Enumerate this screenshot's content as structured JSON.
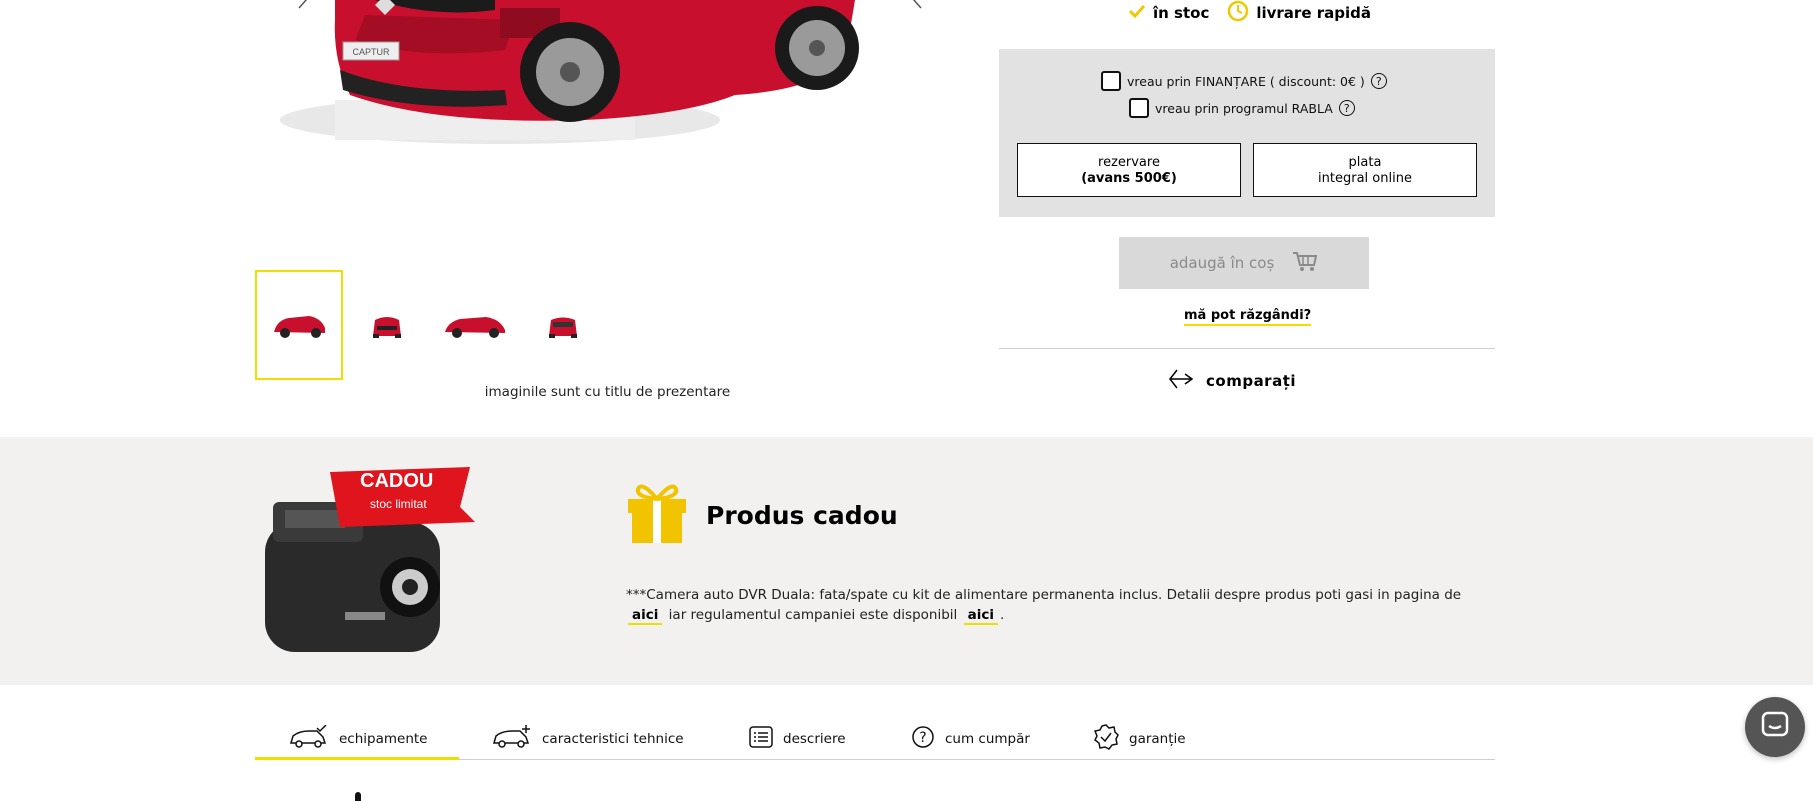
{
  "gallery": {
    "disclaimer": "imaginile sunt cu titlu de prezentare",
    "plate_text": "CAPTUR",
    "thumbnails": [
      "thumbnail-side",
      "thumbnail-front",
      "thumbnail-side-2",
      "thumbnail-rear"
    ]
  },
  "status": {
    "stock_label": "în stoc",
    "delivery_label": "livrare rapidă"
  },
  "options": {
    "financing_label": "vreau prin FINANȚARE ( discount: 0€ )",
    "rabla_label": "vreau prin programul RABLA",
    "reservation_line1": "rezervare",
    "reservation_line2": "(avans 500€)",
    "payment_line1": "plata",
    "payment_line2": "integral online"
  },
  "actions": {
    "cart_label": "adaugă în coș",
    "rethink_label": "mă pot răzgândi?",
    "compare_label": "comparați"
  },
  "gift": {
    "badge_title": "CADOU",
    "badge_subtitle": "stoc limitat",
    "title": "Produs cadou",
    "text_part1": "***Camera auto DVR Duala: fata/spate cu kit de alimentare permanenta inclus. Detalii despre produs poti gasi in pagina de",
    "link1": "aici",
    "text_part2": "iar regulamentul campaniei este disponibil",
    "link2": "aici",
    "text_part3": "."
  },
  "tabs": [
    {
      "label": "echipamente",
      "icon": "car-check-icon"
    },
    {
      "label": "caracteristici tehnice",
      "icon": "car-plus-icon"
    },
    {
      "label": "descriere",
      "icon": "list-icon"
    },
    {
      "label": "cum cumpăr",
      "icon": "question-circle-icon"
    },
    {
      "label": "garanție",
      "icon": "badge-check-icon"
    }
  ],
  "colors": {
    "accent_yellow": "#efdf00",
    "car_red": "#c8102e",
    "band_gray": "#f2f1ef"
  }
}
